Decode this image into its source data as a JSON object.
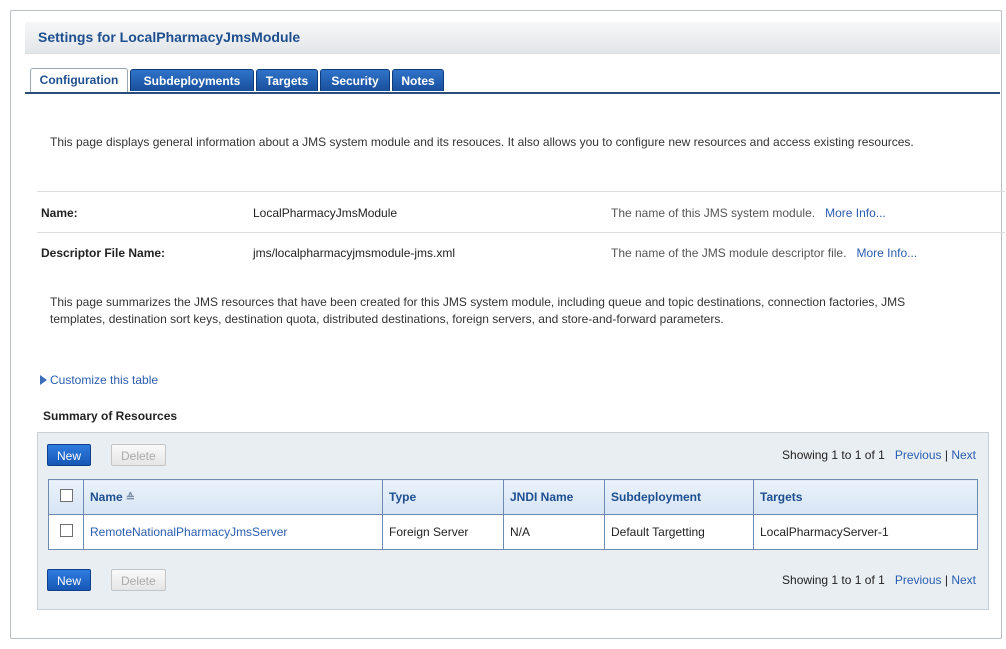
{
  "page": {
    "title": "Settings for LocalPharmacyJmsModule"
  },
  "tabs": [
    {
      "label": "Configuration"
    },
    {
      "label": "Subdeployments"
    },
    {
      "label": "Targets"
    },
    {
      "label": "Security"
    },
    {
      "label": "Notes"
    }
  ],
  "intro_text": "This page displays general information about a JMS system module and its resouces. It also allows you to configure new resources and access existing resources.",
  "properties": [
    {
      "label": "Name:",
      "value": "LocalPharmacyJmsModule",
      "description": "The name of this JMS system module.",
      "more": "More Info..."
    },
    {
      "label": "Descriptor File Name:",
      "value": "jms/localpharmacyjmsmodule-jms.xml",
      "description": "The name of the JMS module descriptor file.",
      "more": "More Info..."
    }
  ],
  "summary_text": "This page summarizes the JMS resources that have been created for this JMS system module, including queue and topic destinations, connection factories, JMS templates, destination sort keys, destination quota, distributed destinations, foreign servers, and store-and-forward parameters.",
  "customize_label": "Customize this table",
  "summary_title": "Summary of Resources",
  "buttons": {
    "new": "New",
    "delete": "Delete"
  },
  "pager": {
    "showing": "Showing 1 to 1 of 1",
    "previous": "Previous",
    "separator": "|",
    "next": "Next"
  },
  "table": {
    "headers": [
      "Name",
      "Type",
      "JNDI Name",
      "Subdeployment",
      "Targets"
    ],
    "sort_glyph": "≙",
    "rows": [
      {
        "name": "RemoteNationalPharmacyJmsServer",
        "type": "Foreign Server",
        "jndi": "N/A",
        "subdeployment": "Default Targetting",
        "targets": "LocalPharmacyServer-1"
      }
    ]
  }
}
